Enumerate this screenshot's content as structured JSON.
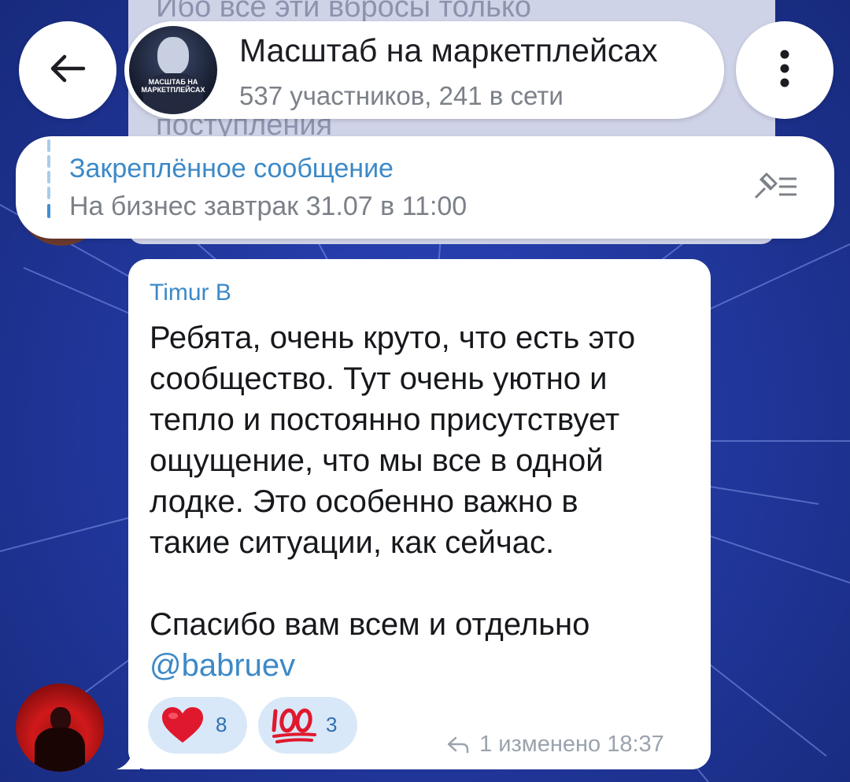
{
  "previous_message": {
    "line_top": "Ибо все эти вбросы только",
    "line_bottom": "поступления"
  },
  "header": {
    "back_icon": "arrow-left-icon",
    "title": "Масштаб на маркетплейсах",
    "subtitle": "537 участников, 241 в сети",
    "avatar_text": "МАСШТАБ НА МАРКЕТПЛЕЙСАХ",
    "menu_icon": "more-vertical-icon"
  },
  "pinned": {
    "title": "Закреплённое сообщение",
    "text": "На бизнес завтрак 31.07 в 11:00",
    "icon": "pinned-list-icon"
  },
  "message": {
    "sender": "Timur B",
    "lines": [
      "Ребята, очень круто, что есть это",
      "сообщество. Тут очень уютно и",
      "тепло и постоянно присутствует",
      "ощущение, что мы все в одной",
      "лодке. Это особенно важно в",
      "такие ситуации, как сейчас.",
      "",
      "Спасибо вам всем и отдельно"
    ],
    "mention": "@babruev",
    "reactions": [
      {
        "emoji": "heart",
        "count": "8"
      },
      {
        "emoji": "hundred-points",
        "count": "3"
      }
    ],
    "replies": "1",
    "edited_label": "изменено",
    "time": "18:37"
  },
  "colors": {
    "accent": "#3c89c8",
    "reaction_bg": "#d8e8f8",
    "background": "#22389f"
  }
}
